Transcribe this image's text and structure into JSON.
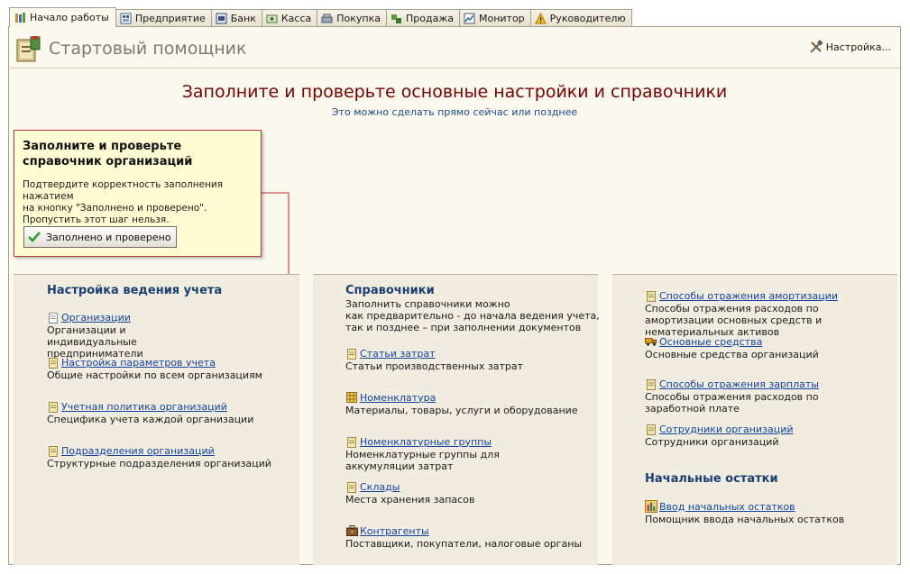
{
  "tabs": [
    {
      "label": "Начало работы",
      "icon": "start-icon",
      "active": true
    },
    {
      "label": "Предприятие",
      "icon": "enterprise-icon",
      "active": false
    },
    {
      "label": "Банк",
      "icon": "bank-icon",
      "active": false
    },
    {
      "label": "Касса",
      "icon": "cash-icon",
      "active": false
    },
    {
      "label": "Покупка",
      "icon": "purchase-icon",
      "active": false
    },
    {
      "label": "Продажа",
      "icon": "sale-icon",
      "active": false
    },
    {
      "label": "Монитор",
      "icon": "monitor-icon",
      "active": false
    },
    {
      "label": "Руководителю",
      "icon": "warning-icon",
      "active": false
    }
  ],
  "header": {
    "title": "Стартовый помощник",
    "settings_label": "Настройка..."
  },
  "main": {
    "heading": "Заполните и проверьте основные настройки и справочники",
    "subheading": "Это можно сделать прямо сейчас или позднее"
  },
  "callout": {
    "title_line1": "Заполните и проверьте",
    "title_line2": "справочник организаций",
    "text_line1": "Подтвердите корректность заполнения нажатием",
    "text_line2": "на кнопку \"Заполнено и проверено\".",
    "text_line3": "Пропустить этот шаг нельзя.",
    "button_label": "Заполнено и проверено"
  },
  "col1": {
    "title": "Настройка ведения учета",
    "items": [
      {
        "link": "Организации",
        "desc": "Организации и индивидуальные предприниматели",
        "icon": "document-icon"
      },
      {
        "link": "Настройка параметров учета",
        "desc": "Общие настройки по всем организациям",
        "icon": "document-icon"
      },
      {
        "link": "Учетная политика организаций",
        "desc": "Специфика учета каждой организации",
        "icon": "document-icon"
      },
      {
        "link": "Подразделения организаций",
        "desc": "Структурные подразделения организаций",
        "icon": "document-icon"
      }
    ]
  },
  "col2": {
    "title": "Справочники",
    "intro_line1": "Заполнить справочники можно",
    "intro_line2": "как предварительно - до начала ведения учета,",
    "intro_line3": "так и позднее – при заполнении документов",
    "items": [
      {
        "link": "Статьи затрат",
        "desc": "Статьи производственных затрат",
        "icon": "document-icon"
      },
      {
        "link": "Номенклатура",
        "desc": "Материалы, товары, услуги и оборудование",
        "icon": "grid-icon"
      },
      {
        "link": "Номенклатурные группы",
        "desc": "Номенклатурные группы для аккумуляции затрат",
        "icon": "document-icon"
      },
      {
        "link": "Склады",
        "desc": "Места хранения запасов",
        "icon": "document-icon"
      },
      {
        "link": "Контрагенты",
        "desc": "Поставщики, покупатели, налоговые органы",
        "icon": "briefcase-icon"
      }
    ]
  },
  "col3": {
    "items": [
      {
        "link": "Способы отражения амортизации",
        "desc": "Способы отражения расходов по амортизации основных средств и нематериальных активов",
        "icon": "document-icon"
      },
      {
        "link": "Основные средства",
        "desc": "Основные средства организаций",
        "icon": "truck-icon"
      },
      {
        "link": "Способы отражения зарплаты",
        "desc": "Способы отражения расходов по заработной плате",
        "icon": "document-icon"
      },
      {
        "link": "Сотрудники организаций",
        "desc": "Сотрудники организаций",
        "icon": "document-icon"
      }
    ],
    "section2_title": "Начальные остатки",
    "section2_item": {
      "link": "Ввод начальных остатков",
      "desc": "Помощник ввода начальных остатков",
      "icon": "balances-icon"
    }
  },
  "colors": {
    "panel_bg": "#fbf8ed",
    "column_bg": "#f0ecdf",
    "heading": "#7b0000",
    "link": "#1345a0",
    "section_title": "#1a3f73",
    "callout_bg": "#fdfcd2",
    "callout_border": "#b33c3c"
  }
}
